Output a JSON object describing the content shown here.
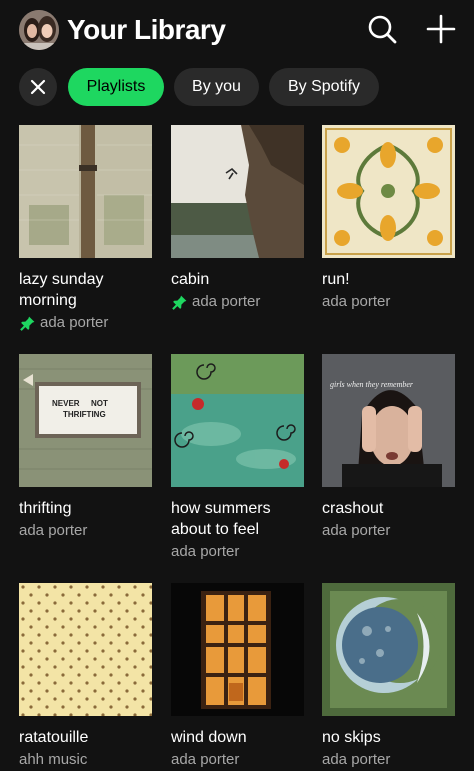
{
  "header": {
    "title": "Your Library",
    "avatar": "avatar",
    "search_icon": "search-icon",
    "add_icon": "plus-icon"
  },
  "filters": {
    "clear_icon": "close-icon",
    "chips": [
      {
        "label": "Playlists",
        "active": true
      },
      {
        "label": "By you",
        "active": false
      },
      {
        "label": "By Spotify",
        "active": false
      }
    ]
  },
  "colors": {
    "background": "#121212",
    "accent": "#1ed760",
    "chip": "#2a2a2a",
    "subtext": "#a7a7a7"
  },
  "playlists": [
    {
      "title_line1": "lazy sunday",
      "title_line2": "morning",
      "owner": "ada porter",
      "pinned": true
    },
    {
      "title_line1": "cabin",
      "owner": "ada porter",
      "pinned": true
    },
    {
      "title_line1": "run!",
      "owner": "ada porter",
      "pinned": false
    },
    {
      "title_line1": "thrifting",
      "owner": "ada porter",
      "pinned": false,
      "cover_text_1": "NEVER",
      "cover_text_2": "NOT",
      "cover_text_3": "THRIFTING"
    },
    {
      "title_line1": "how summers",
      "title_line2": "about to feel",
      "owner": "ada porter",
      "pinned": false
    },
    {
      "title_line1": "crashout",
      "owner": "ada porter",
      "pinned": false,
      "cover_caption": "girls when they remember"
    },
    {
      "title_line1": "ratatouille",
      "owner": "ahh music",
      "pinned": false
    },
    {
      "title_line1": "wind down",
      "owner": "ada porter",
      "pinned": false
    },
    {
      "title_line1": "no skips",
      "owner": "ada porter",
      "pinned": false
    }
  ]
}
